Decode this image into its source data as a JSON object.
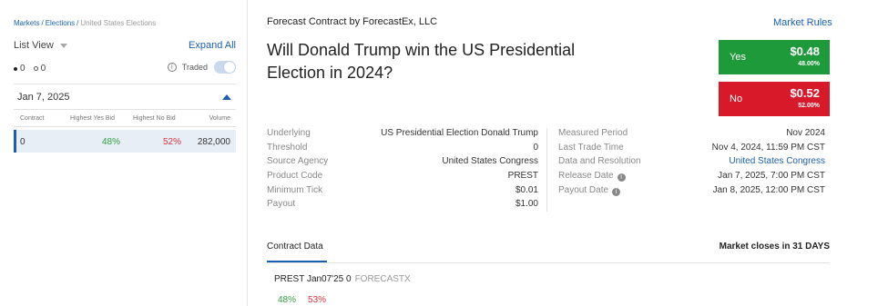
{
  "breadcrumb": {
    "markets": "Markets",
    "elections": "Elections",
    "current": "United States Elections",
    "sep": "/"
  },
  "sidebar": {
    "list_view": "List View",
    "expand_all": "Expand All",
    "radio_a": "0",
    "radio_b": "0",
    "traded_label": "Traded",
    "traded_toggle_on": false,
    "date_group": "Jan 7, 2025",
    "columns": {
      "contract": "Contract",
      "yes_bid": "Highest Yes Bid",
      "no_bid": "Highest No Bid",
      "volume": "Volume"
    },
    "rows": [
      {
        "contract": "0",
        "yes_bid": "48%",
        "no_bid": "52%",
        "volume": "282,000"
      }
    ]
  },
  "main": {
    "provider": "Forecast Contract by ForecastEx, LLC",
    "market_rules": "Market Rules",
    "question": "Will Donald Trump win the US Presidential Election in 2024?",
    "yes": {
      "label": "Yes",
      "price": "$0.48",
      "pct": "48.00%"
    },
    "no": {
      "label": "No",
      "price": "$0.52",
      "pct": "52.00%"
    },
    "details_left": [
      {
        "k": "Underlying",
        "v": "US Presidential Election Donald Trump"
      },
      {
        "k": "Threshold",
        "v": "0"
      },
      {
        "k": "Source Agency",
        "v": "United States Congress"
      },
      {
        "k": "Product Code",
        "v": "PREST"
      },
      {
        "k": "Minimum Tick",
        "v": "$0.01"
      },
      {
        "k": "Payout",
        "v": "$1.00"
      }
    ],
    "details_right": [
      {
        "k": "Measured Period",
        "v": "Nov 2024"
      },
      {
        "k": "Last Trade Time",
        "v": "Nov 4, 2024, 11:59 PM CST"
      },
      {
        "k": "Data and Resolution",
        "v": "United States Congress"
      },
      {
        "k": "Release Date",
        "v": "Jan 7, 2025, 7:00 PM CST"
      },
      {
        "k": "Payout Date",
        "v": "Jan 8, 2025, 12:00 PM CST"
      }
    ],
    "tab_contract_data": "Contract Data",
    "market_closes": "Market closes in 31 DAYS",
    "contract_name": "PREST Jan07'25 0",
    "contract_source": "FORECASTX",
    "mini_yes": "48%",
    "mini_no": "53%"
  },
  "colors": {
    "accent": "#1b5fb0",
    "yes": "#1e9a3a",
    "no": "#d7192a"
  },
  "icons": {
    "info": "info-circle-icon",
    "caret_down": "chevron-down-icon",
    "caret_up": "chevron-up-icon"
  }
}
